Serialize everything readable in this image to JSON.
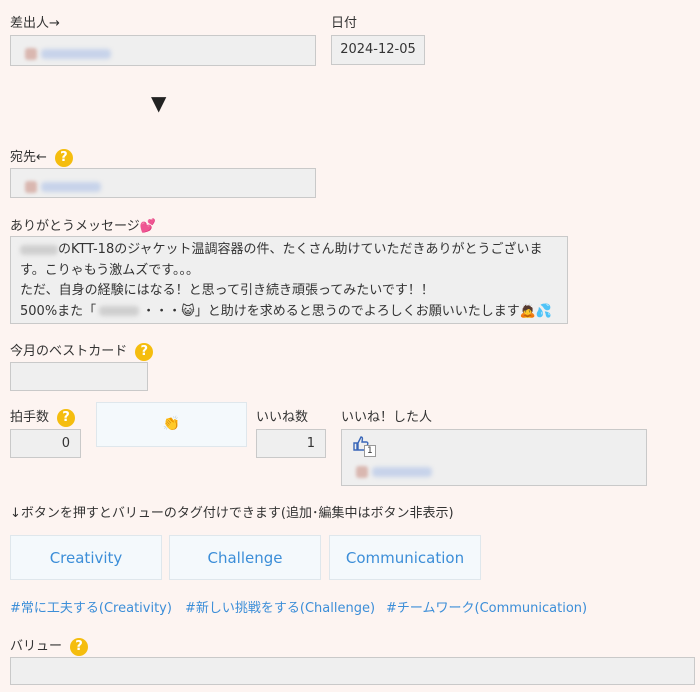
{
  "sender": {
    "label": "差出人→"
  },
  "date": {
    "label": "日付",
    "value": "2024-12-05"
  },
  "arrow": "▼",
  "recipient": {
    "label": "宛先←",
    "help": "?"
  },
  "message": {
    "label": "ありがとうメッセージ💕",
    "lines": [
      "のKTT-18のジャケット温調容器の件、たくさん助けていただきありがとうございま",
      "す。こりゃもう激ムズです。。。",
      "ただ、自身の経験にはなる！と思って引き続き頑張ってみたいです！！",
      "500%また「",
      "・・・😺」と助けを求めると思うのでよろしくお願いいたします🙇💦"
    ]
  },
  "best_card": {
    "label": "今月のベストカード",
    "help": "?"
  },
  "applause": {
    "label": "拍手数",
    "help": "?",
    "value": "0",
    "button_icon": "👏"
  },
  "likes": {
    "label": "いいね数",
    "value": "1"
  },
  "liked_by": {
    "label": "いいね！した人",
    "thumb_count": "1"
  },
  "hint": "↓ボタンを押すとバリューのタグ付けできます(追加･編集中はボタン非表示)",
  "value_buttons": [
    "Creativity",
    "Challenge",
    "Communication"
  ],
  "tags": [
    "#常に工夫する(Creativity)",
    "#新しい挑戦をする(Challenge)",
    "#チームワーク(Communication)"
  ],
  "values_field": {
    "label": "バリュー",
    "help": "?"
  },
  "colors": {
    "background": "#fdf4f1",
    "accent": "#3c8ed8",
    "help": "#f5bd0e",
    "field": "#efefef"
  }
}
